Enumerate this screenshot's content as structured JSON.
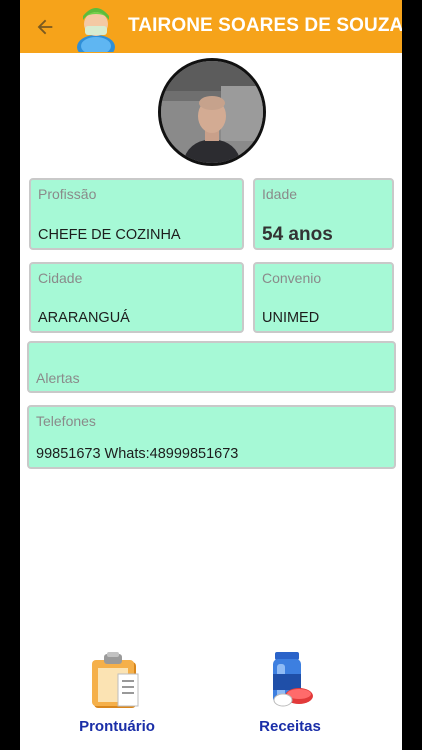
{
  "header": {
    "title": "TAIRONE SOARES DE SOUZA"
  },
  "fields": {
    "profissao": {
      "label": "Profissão",
      "value": "CHEFE DE COZINHA"
    },
    "idade": {
      "label": "Idade",
      "value": "54 anos"
    },
    "cidade": {
      "label": "Cidade",
      "value": "ARARANGUÁ"
    },
    "convenio": {
      "label": "Convenio",
      "value": "UNIMED"
    },
    "alertas": {
      "label": "Alertas",
      "value": ""
    },
    "telefones": {
      "label": "Telefones",
      "value": "99851673 Whats:48999851673"
    }
  },
  "bottom_nav": {
    "prontuario": "Prontuário",
    "receitas": "Receitas"
  },
  "colors": {
    "appbar": "#f6a31a",
    "field_bg": "#a6f9d6",
    "nav_text": "#1a2ea8"
  },
  "icons": {
    "back": "arrow-left-icon",
    "header_avatar": "patient-avatar-icon",
    "prontuario": "clipboard-icon",
    "receitas": "medicine-bottle-icon"
  }
}
